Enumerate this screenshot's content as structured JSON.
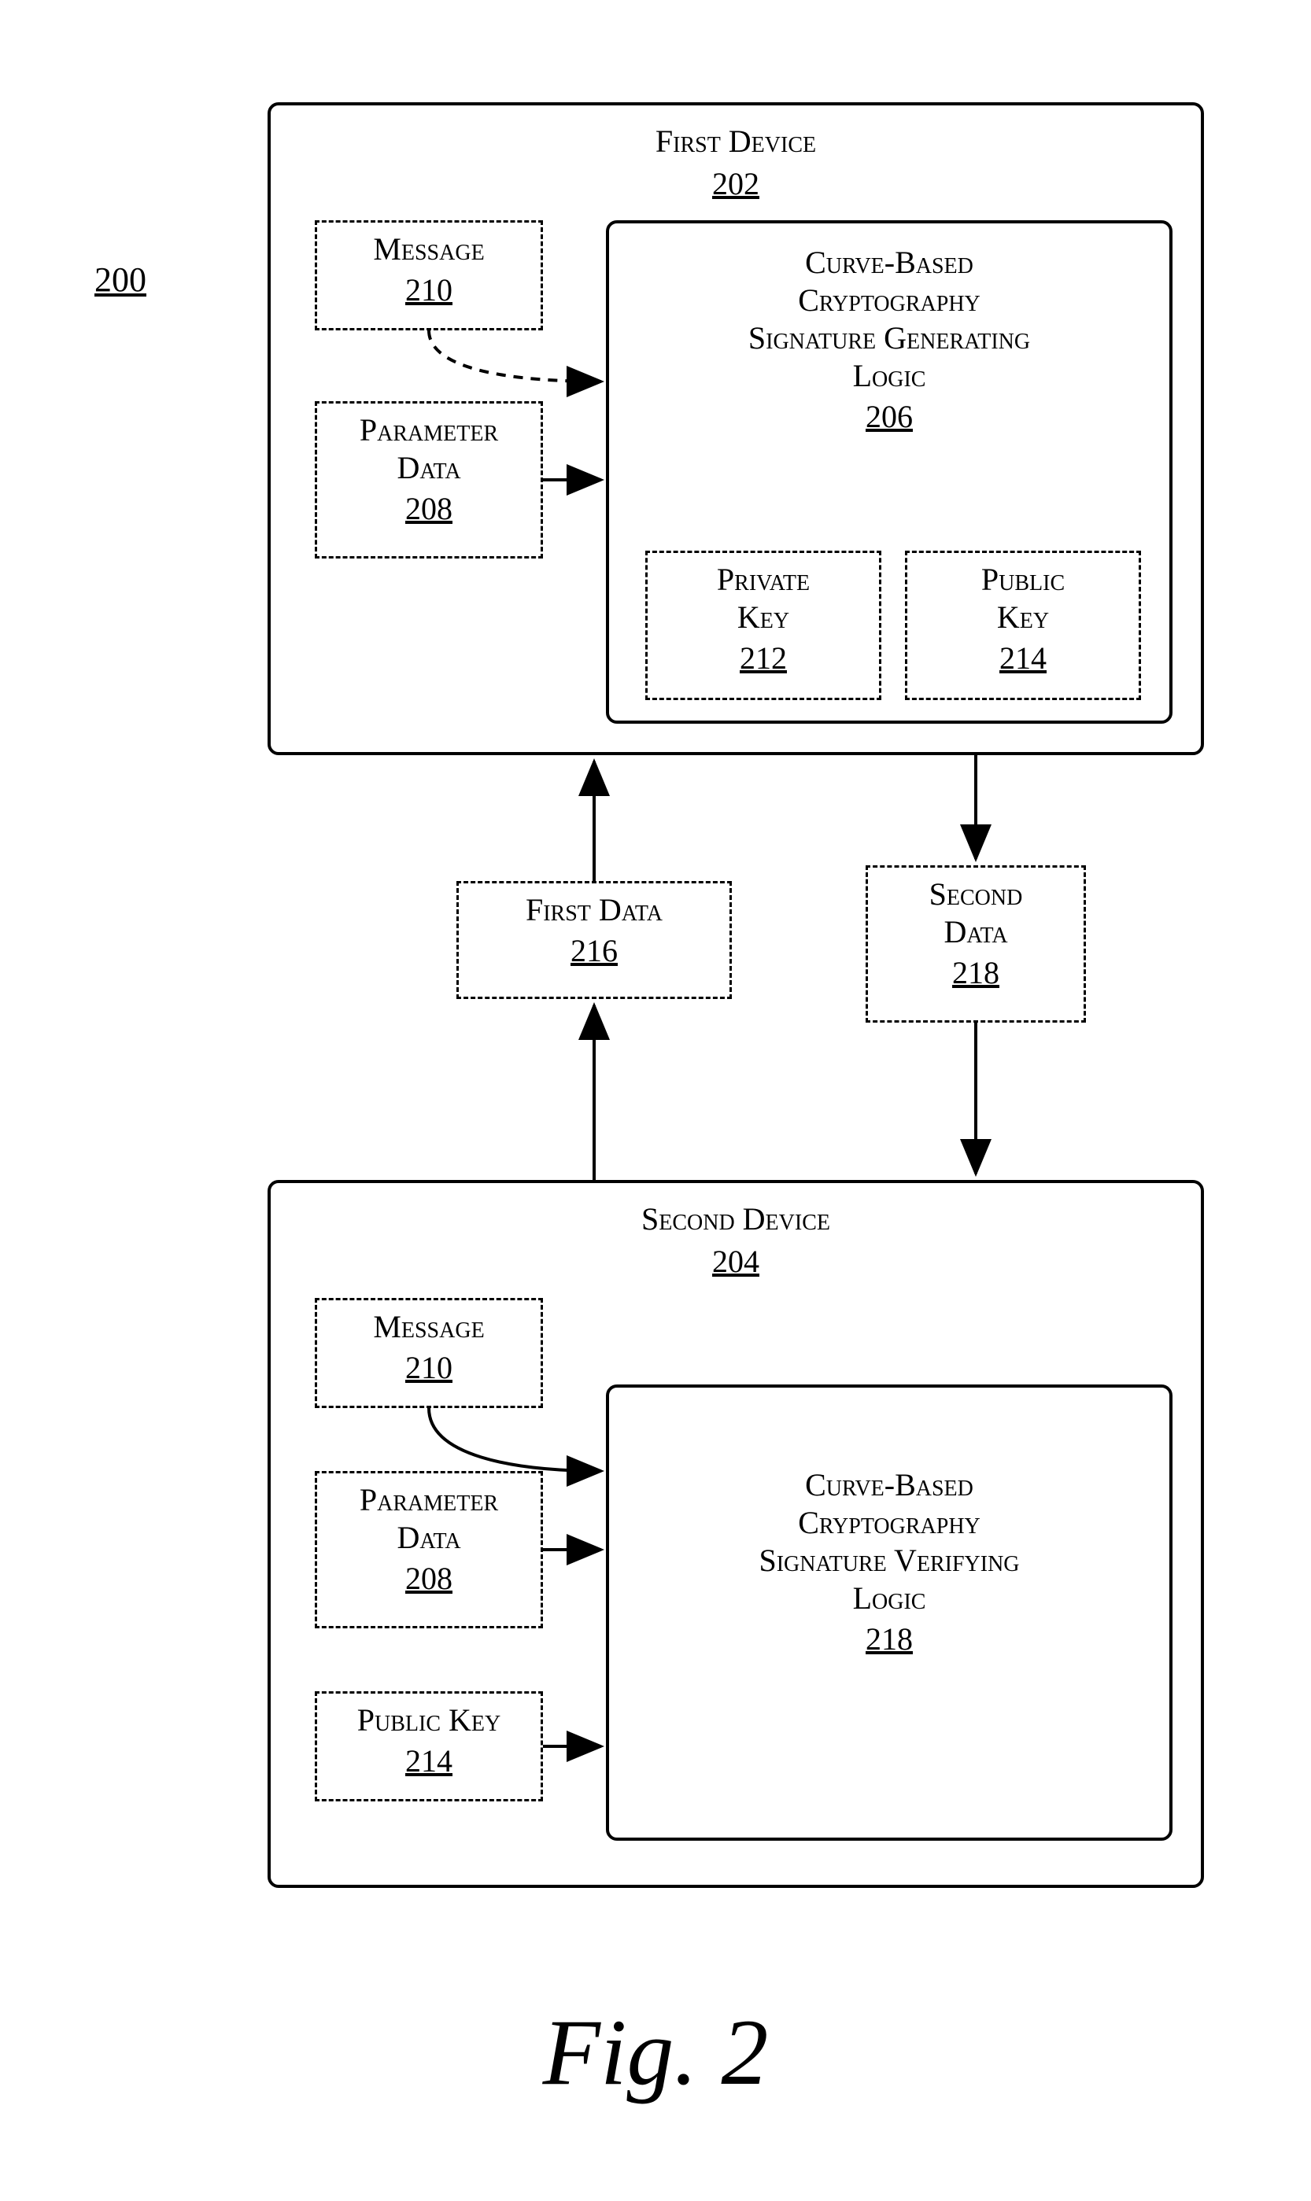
{
  "figure": {
    "number": "200",
    "caption": "Fig. 2"
  },
  "device1": {
    "title": "First Device",
    "ref": "202",
    "message": {
      "title": "Message",
      "ref": "210"
    },
    "param": {
      "title1": "Parameter",
      "title2": "Data",
      "ref": "208"
    },
    "logic": {
      "line1": "Curve-Based",
      "line2": "Cryptography",
      "line3": "Signature Generating",
      "line4": "Logic",
      "ref": "206"
    },
    "priv": {
      "title1": "Private",
      "title2": "Key",
      "ref": "212"
    },
    "pub": {
      "title1": "Public",
      "title2": "Key",
      "ref": "214"
    }
  },
  "exchange": {
    "first": {
      "title": "First Data",
      "ref": "216"
    },
    "second": {
      "title1": "Second",
      "title2": "Data",
      "ref": "218"
    }
  },
  "device2": {
    "title": "Second Device",
    "ref": "204",
    "message": {
      "title": "Message",
      "ref": "210"
    },
    "param": {
      "title1": "Parameter",
      "title2": "Data",
      "ref": "208"
    },
    "pub": {
      "title": "Public Key",
      "ref": "214"
    },
    "logic": {
      "line1": "Curve-Based",
      "line2": "Cryptography",
      "line3": "Signature Verifying",
      "line4": "Logic",
      "ref": "218"
    }
  }
}
